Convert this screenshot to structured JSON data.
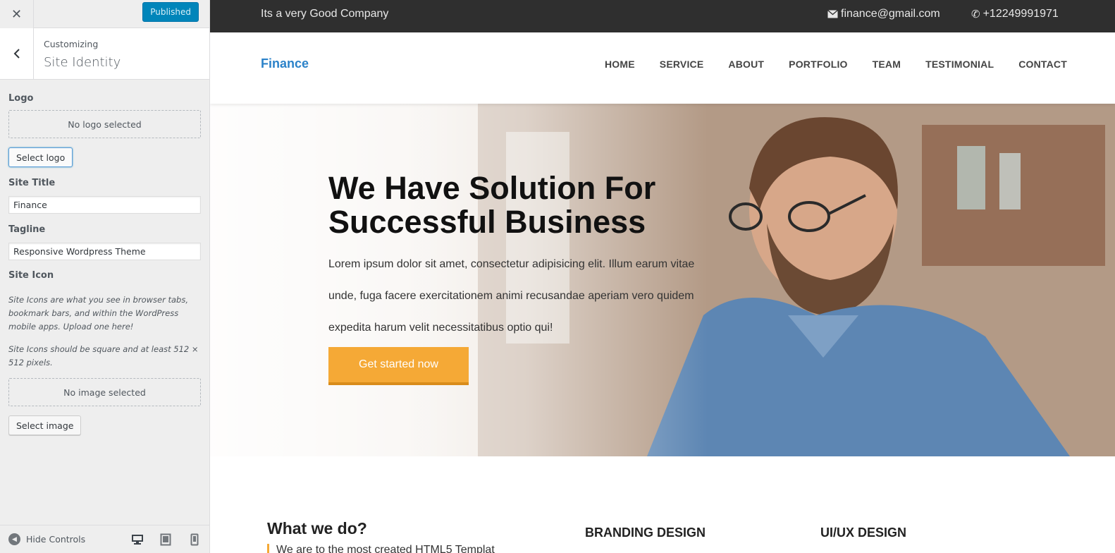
{
  "customizer": {
    "publish_label": "Published",
    "breadcrumb": "Customizing",
    "section_title": "Site Identity",
    "logo": {
      "label": "Logo",
      "placeholder": "No logo selected",
      "button": "Select logo"
    },
    "site_title": {
      "label": "Site Title",
      "value": "Finance"
    },
    "tagline": {
      "label": "Tagline",
      "value": "Responsive Wordpress Theme"
    },
    "site_icon": {
      "label": "Site Icon",
      "description_1": "Site Icons are what you see in browser tabs, bookmark bars, and within the WordPress mobile apps. Upload one here!",
      "description_2": "Site Icons should be square and at least 512 × 512 pixels.",
      "placeholder": "No image selected",
      "button": "Select image"
    },
    "footer": {
      "hide_controls": "Hide Controls"
    }
  },
  "preview": {
    "topbar": {
      "tagline": "Its a very Good Company",
      "email": "finance@gmail.com",
      "phone": "+12249991971"
    },
    "brand": "Finance",
    "menu": [
      "HOME",
      "SERVICE",
      "ABOUT",
      "PORTFOLIO",
      "TEAM",
      "TESTIMONIAL",
      "CONTACT"
    ],
    "hero": {
      "heading": "We Have Solution For Successful Business",
      "body": "Lorem ipsum dolor sit amet, consectetur adipisicing elit. Illum earum vitae unde, fuga facere exercitationem animi recusandae aperiam vero quidem expedita harum velit necessitatibus optio qui!",
      "cta": "Get started now"
    },
    "what_we_do": {
      "title": "What we do?",
      "text": "We are to the most created HTML5 Templat"
    },
    "services": [
      "BRANDING DESIGN",
      "UI/UX DESIGN"
    ]
  },
  "colors": {
    "accent": "#f5a936",
    "brand": "#2b82c9",
    "topbar_bg": "#2f2f2f",
    "wp_blue": "#0085ba"
  }
}
